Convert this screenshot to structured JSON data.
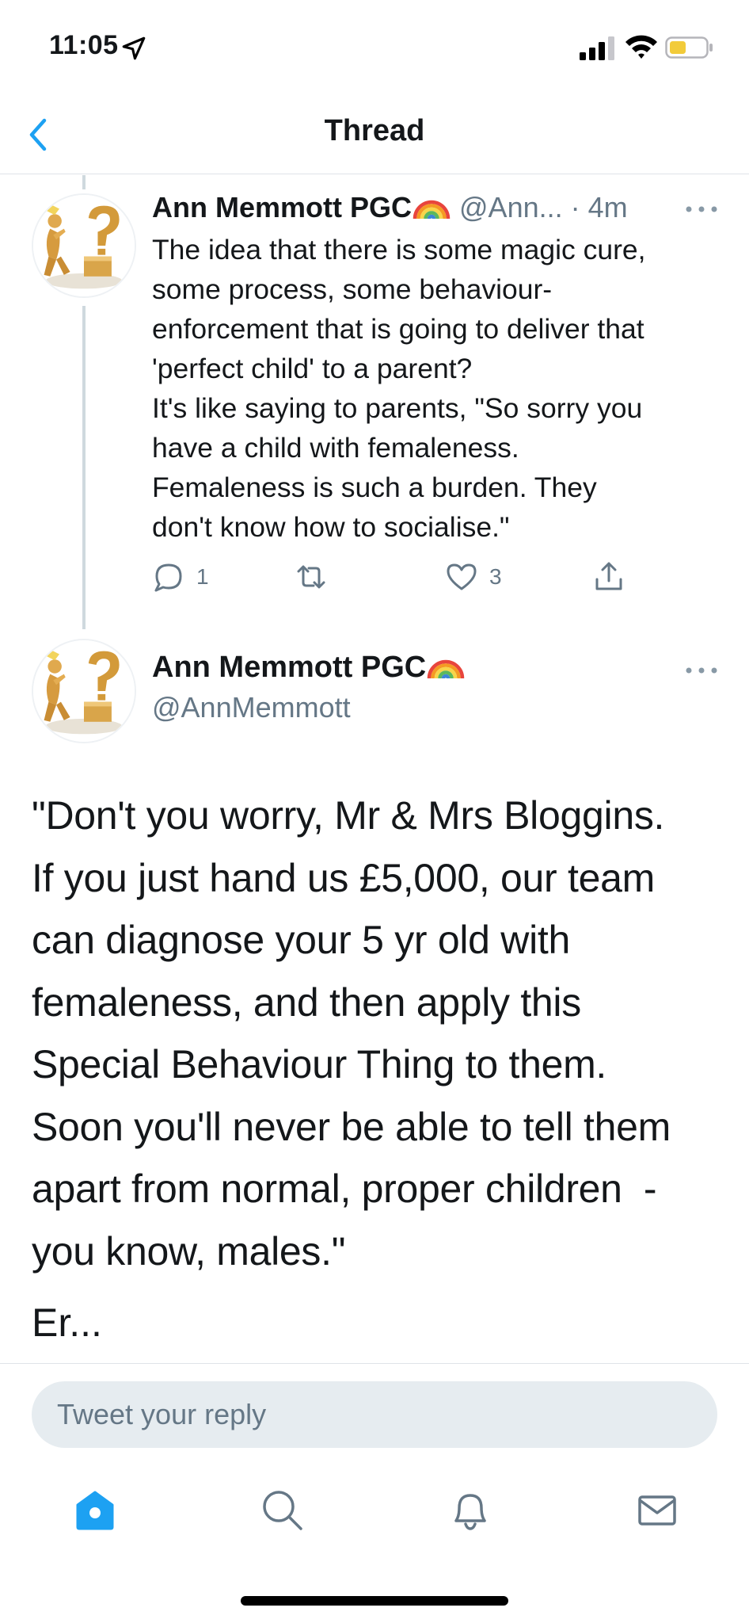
{
  "status_bar": {
    "time": "11:05"
  },
  "nav": {
    "title": "Thread"
  },
  "tweets": [
    {
      "author_name": "Ann Memmott PGC",
      "handle": "@Ann...",
      "time": "· 4m",
      "text": "The idea that there is some magic cure,\nsome process, some behaviour-\nenforcement that is going to deliver that\n'perfect child' to a parent?\nIt's like saying to parents, \"So sorry you\nhave a child with femaleness.\nFemaleness is such a burden. They\ndon't know how to socialise.\"",
      "reply_count": "1",
      "like_count": "3"
    },
    {
      "author_name": "Ann Memmott PGC",
      "handle": "@AnnMemmott",
      "text": "\"Don't you worry, Mr & Mrs Bloggins.\nIf you just hand us £5,000, our team\ncan diagnose your 5 yr old with\nfemaleness, and then apply this\nSpecial Behaviour Thing to them.\nSoon you'll never be able to tell them\napart from normal, proper children  -\nyou know, males.\"",
      "trailing_text": "Er..."
    }
  ],
  "reply": {
    "placeholder": "Tweet your reply"
  },
  "colors": {
    "accent": "#1da1f2",
    "secondary_text": "#657786",
    "divider": "#dfe3e8"
  },
  "icons": {
    "nav": "chevron-left-icon",
    "tabs": [
      "home-icon",
      "search-icon",
      "bell-icon",
      "mail-icon"
    ],
    "actions": [
      "reply-icon",
      "retweet-icon",
      "heart-icon",
      "share-icon"
    ]
  }
}
